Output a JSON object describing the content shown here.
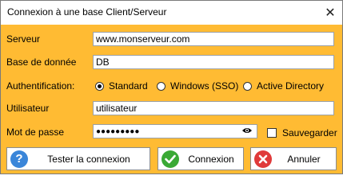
{
  "window": {
    "title": "Connexion à une base Client/Serveur"
  },
  "form": {
    "server": {
      "label": "Serveur",
      "value": "www.monserveur.com"
    },
    "database": {
      "label": "Base de donnée",
      "value": "DB"
    },
    "auth": {
      "label": "Authentification:",
      "options": [
        "Standard",
        "Windows (SSO)",
        "Active Directory"
      ],
      "selected": "Standard"
    },
    "user": {
      "label": "Utilisateur",
      "value": "utilisateur"
    },
    "password": {
      "label": "Mot de passe",
      "masked_value": "●●●●●●●●●"
    },
    "save": {
      "label": "Sauvegarder",
      "checked": false
    }
  },
  "buttons": {
    "test": {
      "label": "Tester la connexion",
      "icon": "question-icon",
      "color": "#3a86d9"
    },
    "connect": {
      "label": "Connexion",
      "icon": "check-icon",
      "color": "#3aa935"
    },
    "cancel": {
      "label": "Annuler",
      "icon": "cancel-icon",
      "color": "#e03a3a"
    }
  },
  "colors": {
    "panel_background": "#ffbb33"
  }
}
